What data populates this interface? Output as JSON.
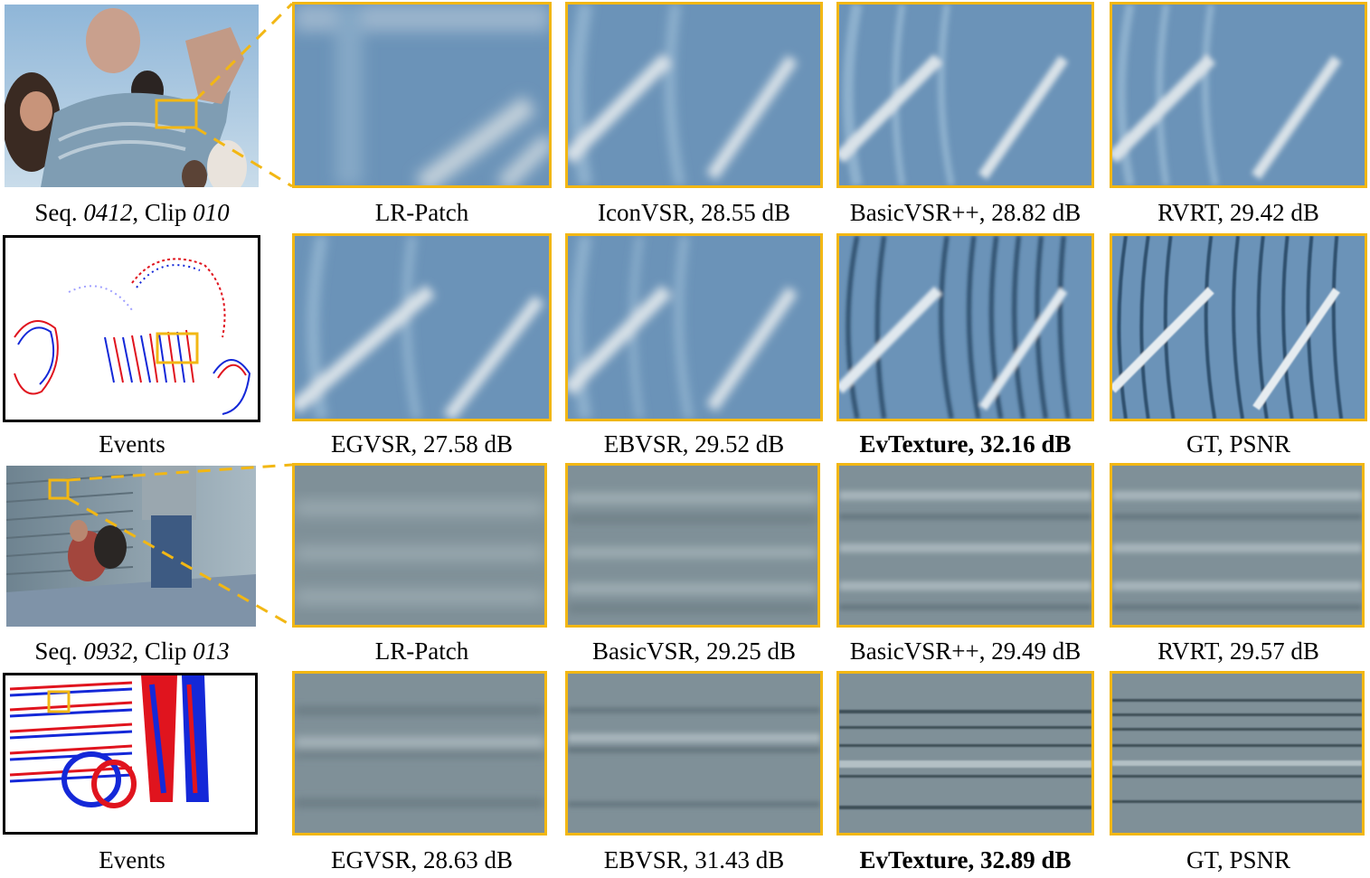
{
  "colors": {
    "highlight_box": "#F2B714",
    "event_positive": "#E0141E",
    "event_negative": "#1428D8",
    "stripe_blue": "#5E8CB2",
    "stripe_gray": "#7D9299"
  },
  "row1": {
    "context": {
      "seq_label": "Seq. ",
      "seq_id": "0412",
      "clip_label": ", Clip ",
      "clip_id": "010"
    },
    "captions": [
      "LR-Patch",
      "IconVSR, 28.55 dB",
      "BasicVSR++, 28.82 dB",
      "RVRT, 29.42 dB"
    ]
  },
  "row2": {
    "events_label": "Events",
    "captions": [
      "EGVSR, 27.58 dB",
      "EBVSR, 29.52 dB",
      "EvTexture, 32.16 dB",
      "GT, PSNR"
    ]
  },
  "row3": {
    "context": {
      "seq_label": "Seq. ",
      "seq_id": "0932",
      "clip_label": ", Clip ",
      "clip_id": "013"
    },
    "captions": [
      "LR-Patch",
      "BasicVSR, 29.25 dB",
      "BasicVSR++, 29.49 dB",
      "RVRT, 29.57 dB"
    ]
  },
  "row4": {
    "events_label": "Events",
    "captions": [
      "EGVSR, 28.63 dB",
      "EBVSR, 31.43 dB",
      "EvTexture, 32.89 dB",
      "GT, PSNR"
    ]
  }
}
